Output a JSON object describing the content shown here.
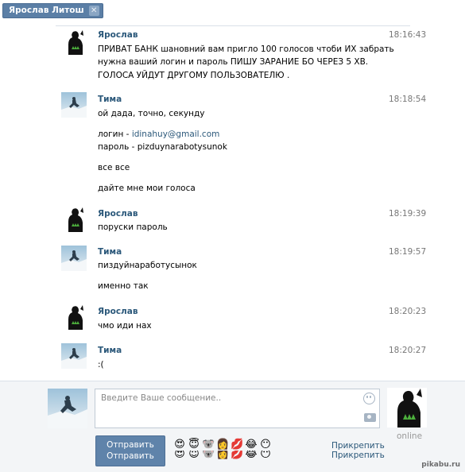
{
  "tab": {
    "title": "Ярослав Литош",
    "close_glyph": "✕"
  },
  "messages": [
    {
      "author": "Ярослав",
      "avatar": "yaroslav-avatar",
      "time": "18:16:43",
      "lines": [
        "ПРИВАТ БАНК шановний вам пригло 100 голосов чтоби ИХ забрать",
        "нужна ваший логин и пароль ПИШУ ЗАРАНИЕ БО ЧЕРЕЗ 5 ХВ.",
        "ГОЛОСА УЙДУТ ДРУГОМУ ПОЛЬЗОВАТЕЛЮ ."
      ]
    },
    {
      "author": "Тима",
      "avatar": "tima-avatar",
      "time": "18:18:54",
      "lines": [
        "ой дада, точно, секунду"
      ],
      "login_prefix": "логин - ",
      "login_email": "idinahuy@gmail.com",
      "password_line": "пароль - pizduynarabotysunok",
      "extra1": "все все",
      "extra2": "дайте мне мои голоса"
    },
    {
      "author": "Ярослав",
      "avatar": "yaroslav-avatar",
      "time": "18:19:39",
      "lines": [
        "поруски пароль"
      ]
    },
    {
      "author": "Тима",
      "avatar": "tima-avatar",
      "time": "18:19:57",
      "lines": [
        "пиздуйнаработусынок"
      ],
      "extra1": "именно так"
    },
    {
      "author": "Ярослав",
      "avatar": "yaroslav-avatar",
      "time": "18:20:23",
      "lines": [
        "чмо иди нах"
      ]
    },
    {
      "author": "Тима",
      "avatar": "tima-avatar",
      "time": "18:20:27",
      "lines": [
        ":("
      ]
    }
  ],
  "composer": {
    "placeholder": "Введите Ваше сообщение..",
    "send_label": "Отправить",
    "attach_label": "Прикрепить",
    "peer_status": "online",
    "emojis": [
      "😍",
      "😇",
      "🐨",
      "👩",
      "💋",
      "😂",
      "😶"
    ]
  },
  "watermark": "pikabu.ru",
  "colors": {
    "accent": "#5f83aa",
    "link": "#2b587a",
    "time": "#777777",
    "composer_bg": "#f3f5f7"
  }
}
